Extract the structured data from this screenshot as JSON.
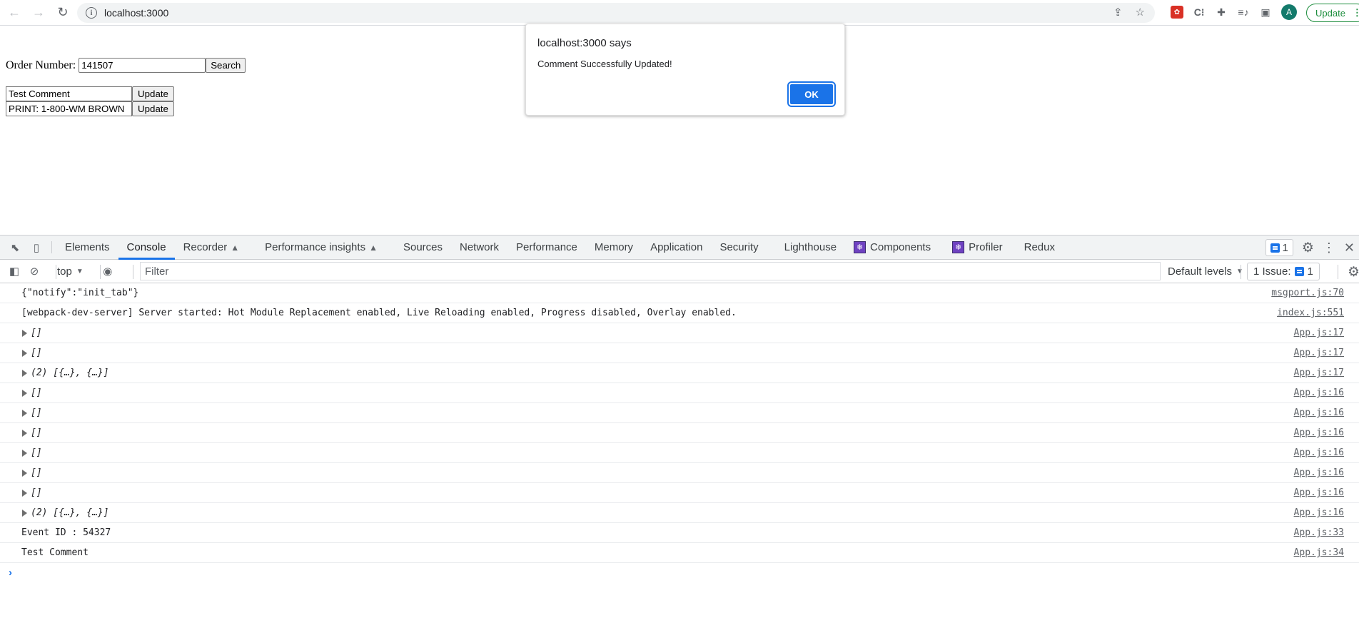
{
  "browser": {
    "url": "localhost:3000",
    "icons": [
      "back-icon",
      "forward-icon",
      "reload-icon",
      "info-icon",
      "share-icon",
      "star-icon"
    ],
    "extensions": [
      "red-bug-extension-icon",
      "c-extension-icon",
      "puzzle-extensions-icon",
      "media-queue-icon",
      "side-panel-icon"
    ],
    "profile_initial": "A",
    "update_label": "Update",
    "menu_glyph": "⋮"
  },
  "page": {
    "order_label": "Order Number:",
    "order_value": "141507",
    "search_label": "Search",
    "comments": [
      {
        "value": "Test Comment",
        "button": "Update"
      },
      {
        "value": "PRINT: 1-800-WM BROWN",
        "button": "Update"
      }
    ]
  },
  "dialog": {
    "title": "localhost:3000 says",
    "message": "Comment Successfully Updated!",
    "ok_label": "OK"
  },
  "devtools": {
    "tabs": [
      {
        "label": "Elements",
        "active": false
      },
      {
        "label": "Console",
        "active": true
      },
      {
        "label": "Recorder",
        "experimental": true
      },
      {
        "label": "Performance insights",
        "experimental": true
      },
      {
        "label": "Sources"
      },
      {
        "label": "Network"
      },
      {
        "label": "Performance"
      },
      {
        "label": "Memory"
      },
      {
        "label": "Application"
      },
      {
        "label": "Security"
      },
      {
        "label": "Lighthouse"
      },
      {
        "label": "Components",
        "react": true
      },
      {
        "label": "Profiler",
        "react": true
      },
      {
        "label": "Redux"
      }
    ],
    "issues_count": "1",
    "console_toolbar": {
      "context": "top",
      "filter_placeholder": "Filter",
      "levels": "Default levels",
      "issues_label": "1 Issue:",
      "issues_count": "1"
    },
    "logs": [
      {
        "text": "{\"notify\":\"init_tab\"}",
        "source": "msgport.js:70",
        "expandable": false
      },
      {
        "text": "[webpack-dev-server] Server started: Hot Module Replacement enabled, Live Reloading enabled, Progress disabled, Overlay enabled.",
        "source": "index.js:551",
        "expandable": false
      },
      {
        "text": "[]",
        "source": "App.js:17",
        "expandable": true
      },
      {
        "text": "[]",
        "source": "App.js:17",
        "expandable": true
      },
      {
        "text": "(2) [{…}, {…}]",
        "source": "App.js:17",
        "expandable": true
      },
      {
        "text": "[]",
        "source": "App.js:16",
        "expandable": true
      },
      {
        "text": "[]",
        "source": "App.js:16",
        "expandable": true
      },
      {
        "text": "[]",
        "source": "App.js:16",
        "expandable": true
      },
      {
        "text": "[]",
        "source": "App.js:16",
        "expandable": true
      },
      {
        "text": "[]",
        "source": "App.js:16",
        "expandable": true
      },
      {
        "text": "[]",
        "source": "App.js:16",
        "expandable": true
      },
      {
        "text": "(2) [{…}, {…}]",
        "source": "App.js:16",
        "expandable": true
      },
      {
        "text": "Event ID : 54327",
        "source": "App.js:33",
        "expandable": false
      },
      {
        "text": "Test Comment",
        "source": "App.js:34",
        "expandable": false
      }
    ],
    "prompt_glyph": "›"
  },
  "colors": {
    "accent": "#1a73e8",
    "update_green": "#1e8e3e",
    "react_purple": "#6f42c1"
  }
}
